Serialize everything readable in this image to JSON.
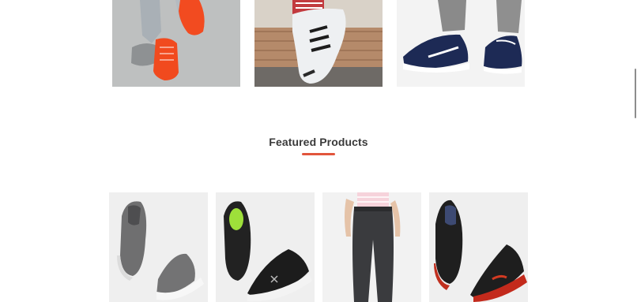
{
  "categories": [
    {
      "image": "red-sneakers-on-concrete",
      "alt": ""
    },
    {
      "image": "striped-white-sneakers-on-brick",
      "alt": ""
    },
    {
      "image": "navy-sneakers-on-white",
      "alt": ""
    }
  ],
  "featured": {
    "title": "Featured Products",
    "accent_color": "#e2553c"
  },
  "products": [
    {
      "image": "grey-slip-on-shoe"
    },
    {
      "image": "black-running-shoe"
    },
    {
      "image": "grey-jogger-pants"
    },
    {
      "image": "black-red-sport-shoe"
    }
  ],
  "colors": {
    "heading": "#3a3a3a",
    "card_background": "#efefef",
    "accent": "#e2553c"
  }
}
